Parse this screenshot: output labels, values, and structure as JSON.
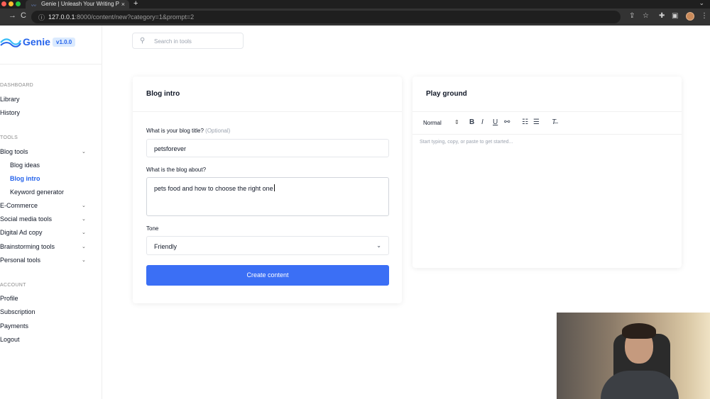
{
  "browser": {
    "tab_title": "Genie | Unleash Your Writing P",
    "tab_close": "×",
    "new_tab": "+",
    "url_host": "127.0.0.1",
    "url_rest": ":8000/content/new?category=1&prompt=2"
  },
  "app": {
    "brand": "Genie",
    "version": "v1.0.0",
    "brand_color": "#2563eb"
  },
  "sidebar": {
    "dashboard_section": "DASHBOARD",
    "library": "Library",
    "history": "History",
    "tools_section": "TOOLS",
    "blog_tools": "Blog tools",
    "blog_ideas": "Blog ideas",
    "blog_intro": "Blog intro",
    "keyword_generator": "Keyword generator",
    "ecommerce": "E-Commerce",
    "social_media_tools": "Social media tools",
    "digital_ad_copy": "Digital Ad copy",
    "brainstorming_tools": "Brainstorming tools",
    "personal_tools": "Personal tools",
    "account_section": "ACCOUNT",
    "profile": "Profile",
    "subscription": "Subscription",
    "payments": "Payments",
    "logout": "Logout"
  },
  "search": {
    "placeholder": "Search in tools"
  },
  "form": {
    "title": "Blog intro",
    "blog_title_label": "What is your blog title?",
    "blog_title_optional": "(Optional)",
    "blog_title_value": "petsforever",
    "about_label": "What is the blog about?",
    "about_value": "pets food and how to choose the right one",
    "tone_label": "Tone",
    "tone_value": "Friendly",
    "submit_label": "Create content",
    "button_color": "#3b6ff5"
  },
  "playground": {
    "title": "Play ground",
    "format_normal": "Normal",
    "editor_placeholder": "Start typing, copy, or paste to get started..."
  }
}
